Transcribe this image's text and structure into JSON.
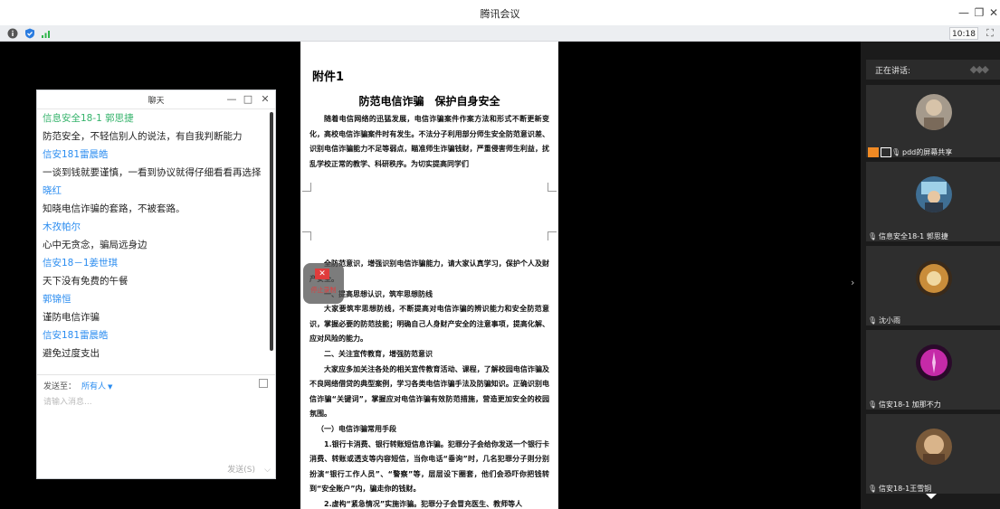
{
  "window": {
    "title": "腾讯会议",
    "controls": [
      "minimize-icon",
      "restore-icon",
      "close-icon"
    ]
  },
  "statusbar": {
    "clock": "10:18",
    "icons": [
      "info-icon",
      "shield-icon",
      "signal-icon",
      "fullscreen-icon"
    ]
  },
  "chat": {
    "title": "聊天",
    "messages": [
      {
        "name": "信息安全18-1 郭思捷",
        "text": "防范安全，不轻信别人的说法，有自我判断能力"
      },
      {
        "name": "信安181雷晨皓",
        "text": "一谈到钱就要谨慎，一看到协议就得仔细看看再选择"
      },
      {
        "name": "晓红",
        "text": "知晓电信诈骗的套路，不被套路。"
      },
      {
        "name": "木孜帕尔",
        "text": "心中无贪念，骗局远身边"
      },
      {
        "name": "信安18－1姜世琪",
        "text": "天下没有免费的午餐"
      },
      {
        "name": "郭锦恒",
        "text": "谨防电信诈骗"
      },
      {
        "name": "信安181雷晨皓",
        "text": "避免过度支出"
      }
    ],
    "send_to_label": "发送至：",
    "send_to_value": "所有人",
    "input_placeholder": "请输入消息...",
    "send_button": "发送(S)"
  },
  "document": {
    "heading": "附件1",
    "title": "防范电信诈骗　保护自身安全",
    "intro": "随着电信网络的迅猛发展，电信诈骗案件作案方法和形式不断更新变化，高校电信诈骗案件时有发生。不法分子利用部分师生安全防范意识差、识别电信诈骗能力不足等弱点，瞄准师生诈骗钱财，严重侵害师生利益，扰乱学校正常的教学、科研秩序。为切实提高同学们",
    "para2": "全防范意识，增强识别电信诈骗能力，请大家认真学习，保护个人及财产安全。",
    "sec1": "一、提高思想认识，筑牢思想防线",
    "para3": "大家要筑牢思想防线，不断提高对电信诈骗的辨识能力和安全防范意识，掌握必要的防范技能；明确自己人身财产安全的注意事项，提高化解、应对风险的能力。",
    "sec2": "二、关注宣传教育，增强防范意识",
    "para4": "大家应多加关注各处的相关宣传教育活动、课程，了解校园电信诈骗及不良网络借贷的典型案例，学习各类电信诈骗手法及防骗知识。正确识别电信诈骗“关键词”，掌握应对电信诈骗有效防范措施，营造更加安全的校园氛围。",
    "sec3": "（一）电信诈骗常用手段",
    "para5": "1.银行卡消费、银行转账短信息诈骗。犯罪分子会给你发送一个银行卡消费、转账或透支等内容短信，当你电话“垂询”时，几名犯罪分子则分别扮演“银行工作人员”、“警察”等，层层设下圈套，他们会恐吓你把钱转到“安全账户”内，骗走你的钱财。",
    "para6": "2.虚构“紧急情况”实施诈骗。犯罪分子会冒充医生、教师等人"
  },
  "record_badge": {
    "label": "停止录制"
  },
  "panel": {
    "speaking_label": "正在讲话:",
    "participants": [
      {
        "name": "pdd的屏幕共享",
        "avatar_color": "#b9a692"
      },
      {
        "name": "信息安全18-1 郭思捷",
        "avatar_color": "#4a7fa3"
      },
      {
        "name": "沈小雨",
        "avatar_color": "#c99a40"
      },
      {
        "name": "信安18-1 加那不力",
        "avatar_color": "#c52aa8"
      },
      {
        "name": "信安18-1王雪铜",
        "avatar_color": "#c4a079"
      }
    ]
  }
}
